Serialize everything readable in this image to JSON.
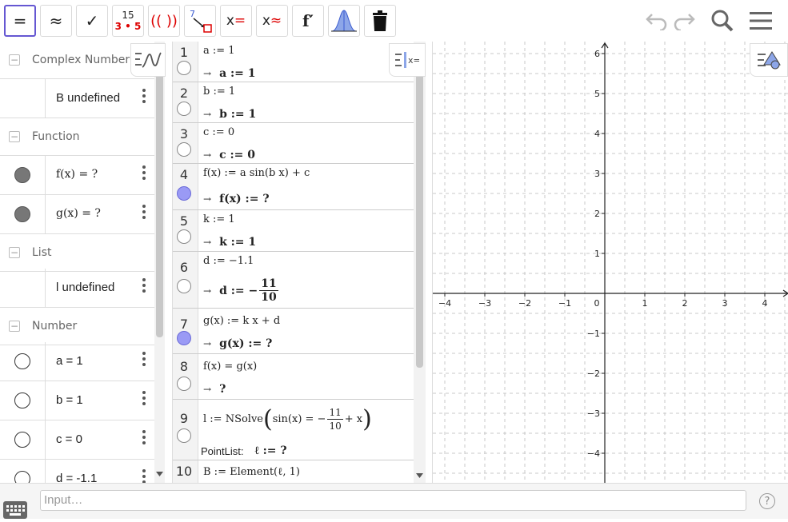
{
  "toolbar": {
    "tools": [
      {
        "id": "evaluate",
        "label": "="
      },
      {
        "id": "numeric",
        "label": "≈"
      },
      {
        "id": "keep-input",
        "label": "✓"
      },
      {
        "id": "factor",
        "top": "15",
        "bottom": "3 • 5"
      },
      {
        "id": "expand",
        "label": "(( ))"
      },
      {
        "id": "substitute",
        "label": "7"
      },
      {
        "id": "solve",
        "label": "x="
      },
      {
        "id": "solve-numeric",
        "label": "x≈"
      },
      {
        "id": "derivative",
        "label": "f′"
      },
      {
        "id": "probability",
        "label": ""
      },
      {
        "id": "delete",
        "label": ""
      }
    ]
  },
  "algebra": {
    "groups": [
      {
        "name": "Complex Number",
        "items": [
          {
            "value": "B undefined",
            "toggle": "none"
          }
        ]
      },
      {
        "name": "Function",
        "items": [
          {
            "value": "f(x)  =  ?",
            "toggle": "filled"
          },
          {
            "value": "g(x)  =  ?",
            "toggle": "filled"
          }
        ]
      },
      {
        "name": "List",
        "items": [
          {
            "value": "l undefined",
            "toggle": "none"
          }
        ]
      },
      {
        "name": "Number",
        "items": [
          {
            "value": "a = 1",
            "toggle": "empty"
          },
          {
            "value": "b = 1",
            "toggle": "empty"
          },
          {
            "value": "c = 0",
            "toggle": "empty"
          },
          {
            "value": "d = -1.1",
            "toggle": "empty"
          }
        ]
      }
    ]
  },
  "cas": {
    "rows": [
      {
        "n": "1",
        "input": "a := 1",
        "output": "a := 1",
        "circle": "empty"
      },
      {
        "n": "2",
        "input": "b := 1",
        "output": "b := 1",
        "circle": "empty"
      },
      {
        "n": "3",
        "input": "c := 0",
        "output": "c := 0",
        "circle": "empty"
      },
      {
        "n": "4",
        "input": "f(x) := a  sin(b x) + c",
        "output": "f(x)  :=  ?",
        "circle": "blue"
      },
      {
        "n": "5",
        "input": "k := 1",
        "output": "k := 1",
        "circle": "empty"
      },
      {
        "n": "6",
        "input": "d := −1.1",
        "output_pre": "d := −",
        "output_num": "11",
        "output_den": "10",
        "circle": "empty"
      },
      {
        "n": "7",
        "input": "g(x) := k x + d",
        "output": "g(x)  :=  ?",
        "circle": "blue"
      },
      {
        "n": "8",
        "input": "f(x) = g(x)",
        "output": "?",
        "circle": "empty"
      },
      {
        "n": "9",
        "input_pre": "l := NSolve",
        "input_mid": "sin(x) = −",
        "input_num": "11",
        "input_den": "10",
        "input_post": "+ x",
        "label": "PointList:",
        "output": "ℓ := ?",
        "circle": "empty"
      },
      {
        "n": "10",
        "input": "B := Element(ℓ, 1)",
        "circle": "empty"
      }
    ]
  },
  "graphics": {
    "xticks": [
      "−4",
      "−3",
      "−2",
      "−1",
      "0",
      "1",
      "2",
      "3",
      "4"
    ],
    "yticks": [
      "6",
      "5",
      "4",
      "3",
      "2",
      "1",
      "−1",
      "−2",
      "−3",
      "−4"
    ]
  },
  "inputbar": {
    "placeholder": "Input…",
    "help": "?"
  }
}
